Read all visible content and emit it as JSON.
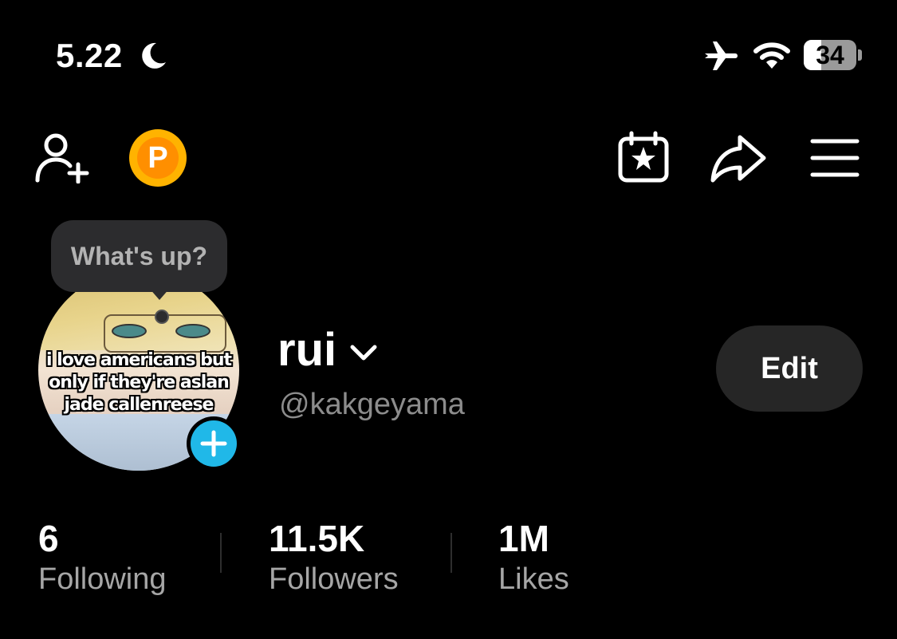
{
  "status_bar": {
    "time": "5.22",
    "battery_level": "34",
    "battery_fraction": 0.34
  },
  "tooltip": {
    "text": "What's up?"
  },
  "avatar": {
    "caption": "i love americans but only if they're aslan jade callenreese"
  },
  "profile": {
    "display_name": "rui",
    "handle": "@kakgeyama",
    "edit_label": "Edit"
  },
  "stats": [
    {
      "value": "6",
      "label": "Following"
    },
    {
      "value": "11.5K",
      "label": "Followers"
    },
    {
      "value": "1M",
      "label": "Likes"
    }
  ],
  "coin": {
    "letter": "P"
  },
  "colors": {
    "accent_blue": "#20b8e8",
    "coin_gold": "#ffb300",
    "background": "#000000"
  },
  "icons": [
    "moon-icon",
    "airplane-icon",
    "wifi-icon",
    "add-friend-icon",
    "calendar-star-icon",
    "share-icon",
    "menu-icon",
    "chevron-down-icon",
    "plus-icon"
  ]
}
